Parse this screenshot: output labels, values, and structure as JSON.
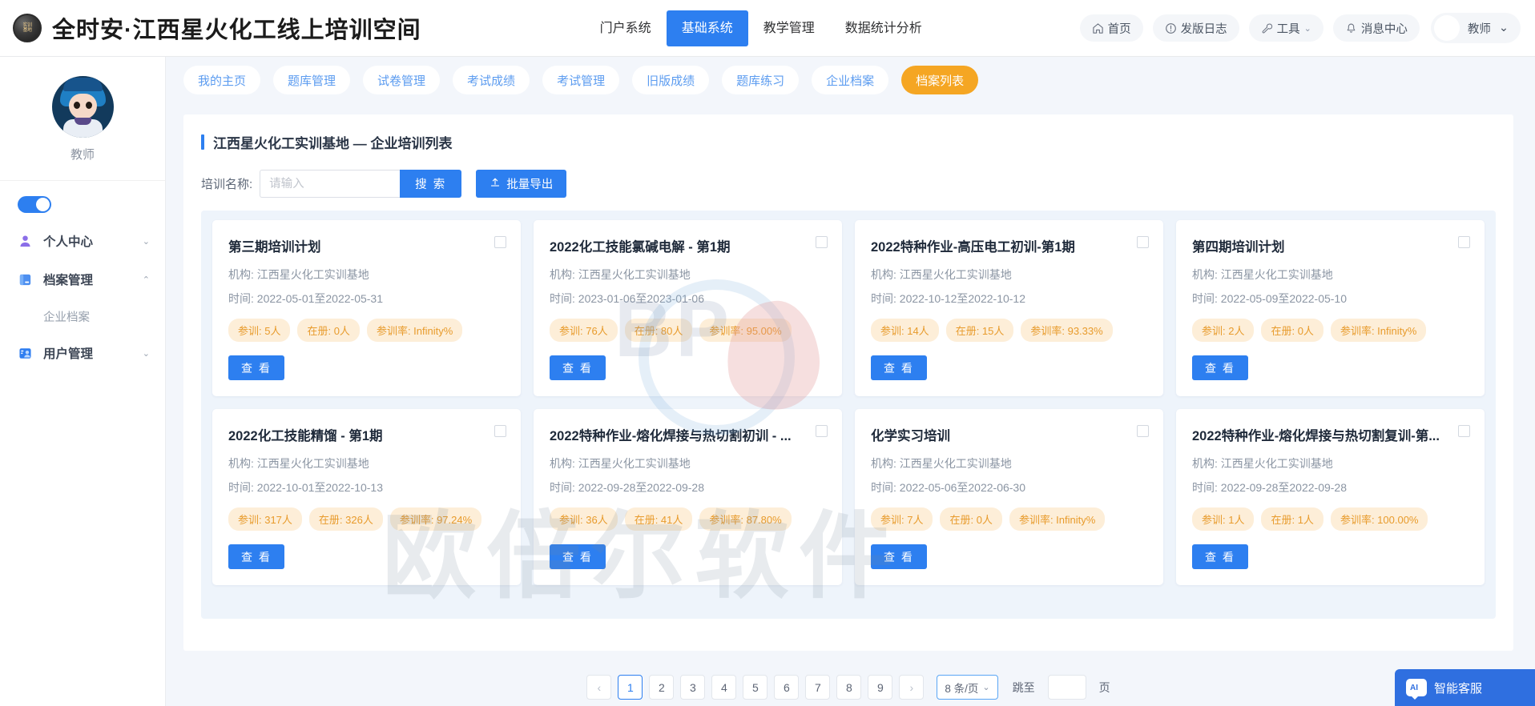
{
  "header": {
    "brand_logo_line1": "实训",
    "brand_logo_line2": "基地",
    "brand_title": "全时安·江西星火化工线上培训空间",
    "nav": [
      {
        "label": "门户系统",
        "active": false
      },
      {
        "label": "基础系统",
        "active": true
      },
      {
        "label": "教学管理",
        "active": false
      },
      {
        "label": "数据统计分析",
        "active": false
      }
    ],
    "pills": [
      {
        "label": "首页",
        "icon": "home-icon"
      },
      {
        "label": "发版日志",
        "icon": "info-circle-icon"
      },
      {
        "label": "工具",
        "icon": "wrench-icon",
        "caret": "⌄"
      },
      {
        "label": "消息中心",
        "icon": "bell-icon"
      }
    ],
    "user": {
      "name": "教师",
      "caret": "⌄"
    }
  },
  "sidebar": {
    "profile_name": "教师",
    "toggle_on": true,
    "items": [
      {
        "label": "个人中心",
        "icon": "user-icon",
        "arrow": "⌄",
        "expanded": false
      },
      {
        "label": "档案管理",
        "icon": "folder-icon",
        "arrow": "⌃",
        "expanded": true
      },
      {
        "label": "用户管理",
        "icon": "users-icon",
        "arrow": "⌄",
        "expanded": false
      }
    ],
    "sub_items": [
      {
        "label": "企业档案",
        "parent": "档案管理"
      }
    ]
  },
  "tabs": [
    {
      "label": "我的主页",
      "active": false
    },
    {
      "label": "题库管理",
      "active": false
    },
    {
      "label": "试卷管理",
      "active": false
    },
    {
      "label": "考试成绩",
      "active": false
    },
    {
      "label": "考试管理",
      "active": false
    },
    {
      "label": "旧版成绩",
      "active": false
    },
    {
      "label": "题库练习",
      "active": false
    },
    {
      "label": "企业档案",
      "active": false
    },
    {
      "label": "档案列表",
      "active": true
    }
  ],
  "panel": {
    "title": "江西星火化工实训基地 — 企业培训列表",
    "search_label": "培训名称:",
    "search_placeholder": "请输入",
    "search_value": "",
    "search_button": "搜 索",
    "export_button": "批量导出"
  },
  "cards": [
    {
      "title": "第三期培训计划",
      "org_label": "机构:",
      "org": "江西星火化工实训基地",
      "time_label": "时间:",
      "time": "2022-05-01至2022-05-31",
      "tags": [
        "参训: 5人",
        "在册: 0人",
        "参训率: Infinity%"
      ],
      "button": "查 看"
    },
    {
      "title": "2022化工技能氯碱电解 - 第1期",
      "org_label": "机构:",
      "org": "江西星火化工实训基地",
      "time_label": "时间:",
      "time": "2023-01-06至2023-01-06",
      "tags": [
        "参训: 76人",
        "在册: 80人",
        "参训率: 95.00%"
      ],
      "button": "查 看"
    },
    {
      "title": "2022特种作业-高压电工初训-第1期",
      "org_label": "机构:",
      "org": "江西星火化工实训基地",
      "time_label": "时间:",
      "time": "2022-10-12至2022-10-12",
      "tags": [
        "参训: 14人",
        "在册: 15人",
        "参训率: 93.33%"
      ],
      "button": "查 看"
    },
    {
      "title": "第四期培训计划",
      "org_label": "机构:",
      "org": "江西星火化工实训基地",
      "time_label": "时间:",
      "time": "2022-05-09至2022-05-10",
      "tags": [
        "参训: 2人",
        "在册: 0人",
        "参训率: Infinity%"
      ],
      "button": "查 看"
    },
    {
      "title": "2022化工技能精馏 - 第1期",
      "org_label": "机构:",
      "org": "江西星火化工实训基地",
      "time_label": "时间:",
      "time": "2022-10-01至2022-10-13",
      "tags": [
        "参训: 317人",
        "在册: 326人",
        "参训率: 97.24%"
      ],
      "button": "查 看"
    },
    {
      "title": "2022特种作业-熔化焊接与热切割初训 - ...",
      "org_label": "机构:",
      "org": "江西星火化工实训基地",
      "time_label": "时间:",
      "time": "2022-09-28至2022-09-28",
      "tags": [
        "参训: 36人",
        "在册: 41人",
        "参训率: 87.80%"
      ],
      "button": "查 看"
    },
    {
      "title": "化学实习培训",
      "org_label": "机构:",
      "org": "江西星火化工实训基地",
      "time_label": "时间:",
      "time": "2022-05-06至2022-06-30",
      "tags": [
        "参训: 7人",
        "在册: 0人",
        "参训率: Infinity%"
      ],
      "button": "查 看"
    },
    {
      "title": "2022特种作业-熔化焊接与热切割复训-第...",
      "org_label": "机构:",
      "org": "江西星火化工实训基地",
      "time_label": "时间:",
      "time": "2022-09-28至2022-09-28",
      "tags": [
        "参训: 1人",
        "在册: 1人",
        "参训率: 100.00%"
      ],
      "button": "查 看"
    }
  ],
  "pagination": {
    "prev": "‹",
    "next": "›",
    "pages": [
      "1",
      "2",
      "3",
      "4",
      "5",
      "6",
      "7",
      "8",
      "9"
    ],
    "current": "1",
    "page_size": "8 条/页",
    "page_size_caret": "⌄",
    "jump_label": "跳至",
    "jump_value": "",
    "jump_suffix": "页"
  },
  "watermark": {
    "big_text": "欧倍尔软件",
    "logo_text": "BP"
  },
  "chat_fab": {
    "label": "智能客服"
  },
  "colors": {
    "primary": "#2d7ff0",
    "accent_orange": "#f5a623",
    "tag_bg": "#fdeed8",
    "tag_text": "#e89b2c"
  }
}
